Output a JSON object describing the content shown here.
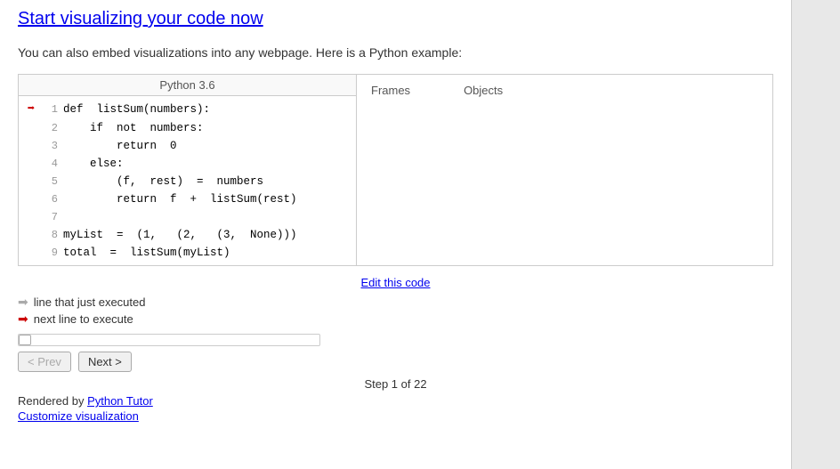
{
  "page": {
    "title": "Start visualizing your code now",
    "embed_text": "You can also embed visualizations into any webpage. Here is a Python example:"
  },
  "code_panel": {
    "header": "Python 3.6",
    "lines": [
      {
        "number": 1,
        "code": "def  listSum(numbers):",
        "arrow": "red"
      },
      {
        "number": 2,
        "code": "    if  not  numbers:",
        "arrow": "none"
      },
      {
        "number": 3,
        "code": "        return  0",
        "arrow": "none"
      },
      {
        "number": 4,
        "code": "    else:",
        "arrow": "none"
      },
      {
        "number": 5,
        "code": "        (f,  rest)  =  numbers",
        "arrow": "none"
      },
      {
        "number": 6,
        "code": "        return  f  +  listSum(rest)",
        "arrow": "none"
      },
      {
        "number": 7,
        "code": "",
        "arrow": "none"
      },
      {
        "number": 8,
        "code": "myList  =  (1,   (2,   (3,  None)))",
        "arrow": "none"
      },
      {
        "number": 9,
        "code": "total  =  listSum(myList)",
        "arrow": "none"
      }
    ],
    "edit_link_text": "Edit this code"
  },
  "frames_panel": {
    "frames_label": "Frames",
    "objects_label": "Objects"
  },
  "legend": {
    "gray_arrow_text": "line that just executed",
    "red_arrow_text": "next line to execute"
  },
  "controls": {
    "prev_label": "< Prev",
    "next_label": "Next >",
    "step_text": "Step 1 of 22",
    "progress_percent": 4
  },
  "footer": {
    "rendered_by_text": "Rendered by ",
    "python_tutor_link": "Python Tutor",
    "customize_link": "Customize visualization"
  }
}
